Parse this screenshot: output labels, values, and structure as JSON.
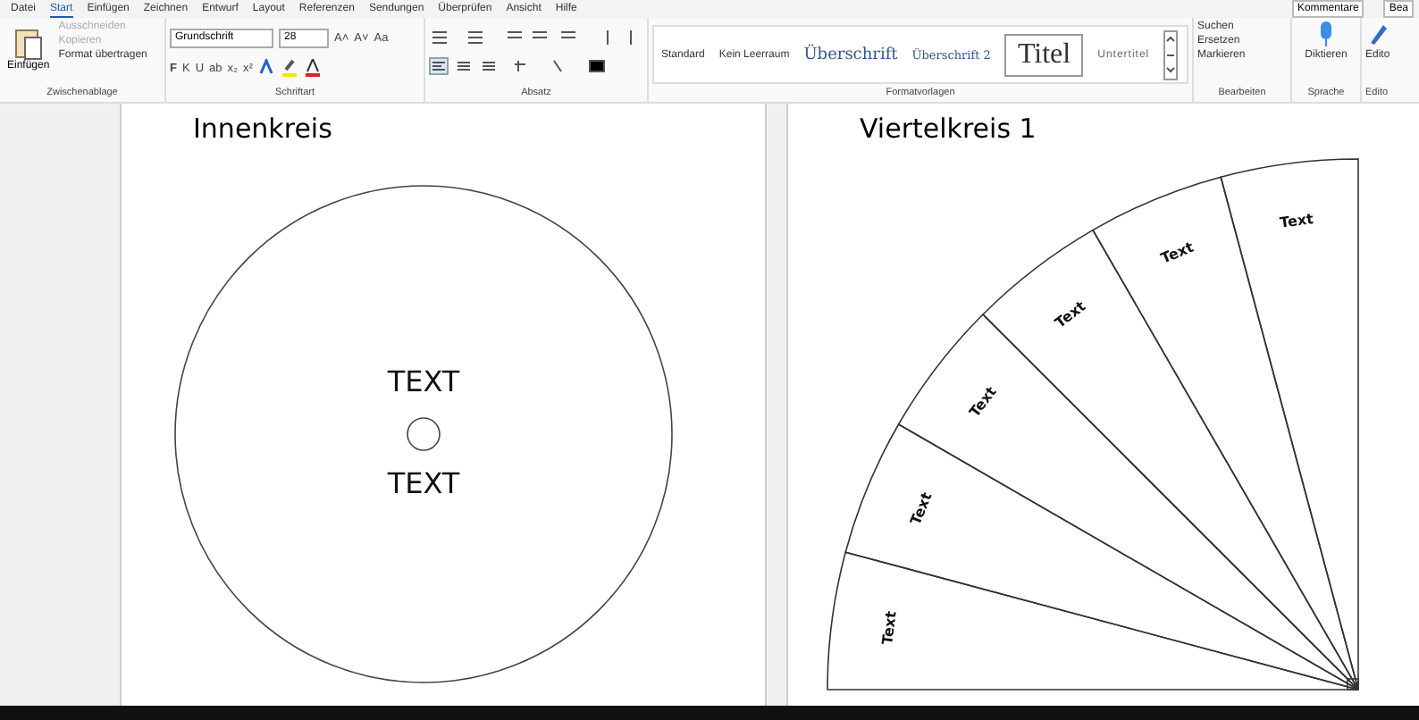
{
  "menu_tabs": [
    {
      "label": "Datei",
      "selected": false
    },
    {
      "label": "Start",
      "selected": true
    },
    {
      "label": "Einfügen",
      "selected": false
    },
    {
      "label": "Zeichnen",
      "selected": false
    },
    {
      "label": "Entwurf",
      "selected": false
    },
    {
      "label": "Layout",
      "selected": false
    },
    {
      "label": "Referenzen",
      "selected": false
    },
    {
      "label": "Sendungen",
      "selected": false
    },
    {
      "label": "Überprüfen",
      "selected": false
    },
    {
      "label": "Ansicht",
      "selected": false
    },
    {
      "label": "Hilfe",
      "selected": false
    }
  ],
  "top_right": [
    "Kommentare",
    "Bea"
  ],
  "clipboard": {
    "paste": "Einfügen",
    "items": [
      {
        "label": "Ausschneiden",
        "disabled": true
      },
      {
        "label": "Kopieren",
        "disabled": true
      },
      {
        "label": "Format übertragen",
        "disabled": false
      }
    ],
    "group": "Zwischenablage"
  },
  "font": {
    "family": "Grundschrift",
    "size": "28",
    "buttons_row1": [
      "A˄",
      "A˅",
      "Aa"
    ],
    "buttons_row2": [
      "F",
      "K",
      "U",
      "ab",
      "x₂",
      "x²"
    ],
    "group": "Schriftart"
  },
  "paragraph": {
    "group": "Absatz"
  },
  "styles": {
    "items": [
      {
        "label": "Standard",
        "kind": "plain",
        "selected": false
      },
      {
        "label": "Kein Leerraum",
        "kind": "plain",
        "selected": false
      },
      {
        "label": "Überschrift",
        "kind": "heading1",
        "selected": false
      },
      {
        "label": "Überschrift 2",
        "kind": "heading2",
        "selected": false
      },
      {
        "label": "Titel",
        "kind": "title",
        "selected": true
      },
      {
        "label": "Untertitel",
        "kind": "subtitle",
        "selected": false
      }
    ],
    "group": "Formatvorlagen"
  },
  "editing": {
    "items": [
      "Suchen",
      "Ersetzen",
      "Markieren"
    ],
    "group": "Bearbeiten"
  },
  "voice": {
    "button": "Diktieren",
    "group": "Sprache"
  },
  "editor": {
    "button": "Edito",
    "group": "Edito"
  },
  "left_page": {
    "title": "Innenkreis",
    "texts": [
      "TEXT",
      "TEXT"
    ]
  },
  "right_page": {
    "title": "Viertelkreis 1",
    "sectors": [
      {
        "label": "Text"
      },
      {
        "label": "Text"
      },
      {
        "label": "Text"
      },
      {
        "label": "Text"
      },
      {
        "label": "Text"
      },
      {
        "label": "Text"
      }
    ]
  }
}
